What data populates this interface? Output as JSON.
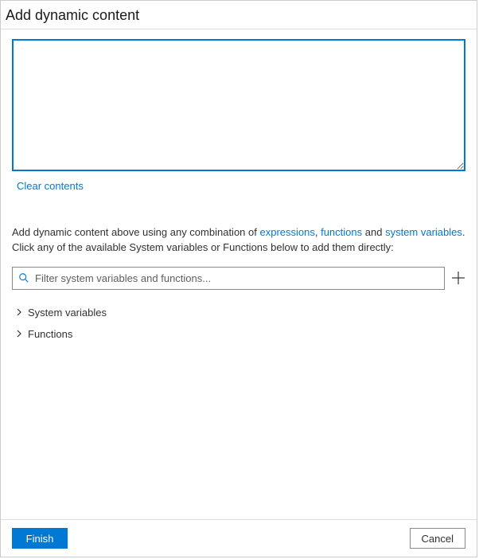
{
  "header": {
    "title": "Add dynamic content"
  },
  "editor": {
    "value": "",
    "clear_label": "Clear contents"
  },
  "help": {
    "prefix": "Add dynamic content above using any combination of ",
    "link_expressions": "expressions",
    "sep1": ", ",
    "link_functions": "functions",
    "sep2": " and ",
    "link_system_vars": "system variables",
    "suffix": ". Click any of the available System variables or Functions below to add them directly:"
  },
  "filter": {
    "placeholder": "Filter system variables and functions..."
  },
  "tree": {
    "system_variables_label": "System variables",
    "functions_label": "Functions"
  },
  "footer": {
    "finish_label": "Finish",
    "cancel_label": "Cancel"
  }
}
